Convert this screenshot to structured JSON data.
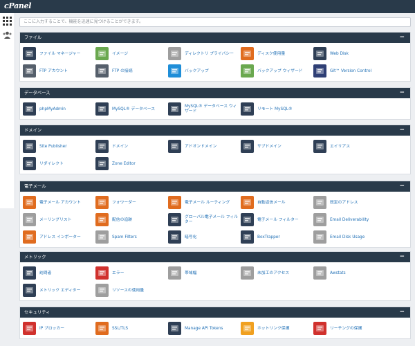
{
  "app": {
    "logo": "cPanel"
  },
  "search": {
    "placeholder": "ここに入力することで、機能を迅速に見つけることができます。"
  },
  "sections": [
    {
      "title": "ファイル",
      "toggle": "−",
      "items": [
        {
          "label": "ファイル マネージャー",
          "icon": "file-manager-icon",
          "color": "#2f3f55"
        },
        {
          "label": "イメージ",
          "icon": "images-icon",
          "color": "#6aa84f"
        },
        {
          "label": "ディレクトリ プライバシー",
          "icon": "folder-privacy-icon",
          "color": "#9e9e9e"
        },
        {
          "label": "ディスク使用量",
          "icon": "disk-usage-icon",
          "color": "#e06c1f"
        },
        {
          "label": "Web Disk",
          "icon": "web-disk-icon",
          "color": "#2f3f55"
        },
        {
          "label": "FTP アカウント",
          "icon": "ftp-accounts-icon",
          "color": "#555f6b"
        },
        {
          "label": "FTP の接続",
          "icon": "ftp-connections-icon",
          "color": "#555f6b"
        },
        {
          "label": "バックアップ",
          "icon": "backup-icon",
          "color": "#1f8ed8"
        },
        {
          "label": "バックアップ ウィザード",
          "icon": "backup-wizard-icon",
          "color": "#6aa84f"
        },
        {
          "label": "Git™ Version Control",
          "icon": "git-icon",
          "color": "#2f3f75"
        }
      ]
    },
    {
      "title": "データベース",
      "toggle": "−",
      "items": [
        {
          "label": "phpMyAdmin",
          "icon": "phpmyadmin-icon",
          "color": "#2f3f55"
        },
        {
          "label": "MySQL® データベース",
          "icon": "mysql-databases-icon",
          "color": "#2f3f55"
        },
        {
          "label": "MySQL® データベース ウィザード",
          "icon": "mysql-wizard-icon",
          "color": "#2f3f55"
        },
        {
          "label": "リモート MySQL®",
          "icon": "remote-mysql-icon",
          "color": "#2f3f55"
        }
      ]
    },
    {
      "title": "ドメイン",
      "toggle": "−",
      "items": [
        {
          "label": "Site Publisher",
          "icon": "site-publisher-icon",
          "color": "#2f3f55"
        },
        {
          "label": "ドメイン",
          "icon": "domains-icon",
          "color": "#2f3f55"
        },
        {
          "label": "アドオンドメイン",
          "icon": "addon-domains-icon",
          "color": "#2f3f55"
        },
        {
          "label": "サブドメイン",
          "icon": "subdomains-icon",
          "color": "#2f3f55"
        },
        {
          "label": "エイリアス",
          "icon": "aliases-icon",
          "color": "#2f3f55"
        },
        {
          "label": "リダイレクト",
          "icon": "redirects-icon",
          "color": "#2f3f55"
        },
        {
          "label": "Zone Editor",
          "icon": "zone-editor-icon",
          "color": "#2f3f55"
        }
      ]
    },
    {
      "title": "電子メール",
      "toggle": "−",
      "items": [
        {
          "label": "電子メール アカウント",
          "icon": "email-accounts-icon",
          "color": "#e06c1f"
        },
        {
          "label": "フォワーダー",
          "icon": "forwarders-icon",
          "color": "#e06c1f"
        },
        {
          "label": "電子メール ルーティング",
          "icon": "email-routing-icon",
          "color": "#e06c1f"
        },
        {
          "label": "自動返信メール",
          "icon": "autoresponders-icon",
          "color": "#e06c1f"
        },
        {
          "label": "既定のアドレス",
          "icon": "default-address-icon",
          "color": "#9e9e9e"
        },
        {
          "label": "メーリングリスト",
          "icon": "mailing-lists-icon",
          "color": "#9e9e9e"
        },
        {
          "label": "配信の追跡",
          "icon": "track-delivery-icon",
          "color": "#e06c1f"
        },
        {
          "label": "グローバル電子メール フィルター",
          "icon": "global-filters-icon",
          "color": "#2f3f55"
        },
        {
          "label": "電子メール フィルター",
          "icon": "email-filters-icon",
          "color": "#2f3f55"
        },
        {
          "label": "Email Deliverability",
          "icon": "email-deliverability-icon",
          "color": "#9e9e9e"
        },
        {
          "label": "アドレス インポーター",
          "icon": "address-importer-icon",
          "color": "#e06c1f"
        },
        {
          "label": "Spam Filters",
          "icon": "spam-filters-icon",
          "color": "#9e9e9e"
        },
        {
          "label": "暗号化",
          "icon": "encryption-icon",
          "color": "#2f3f55"
        },
        {
          "label": "BoxTrapper",
          "icon": "boxtrapper-icon",
          "color": "#2f3f55"
        },
        {
          "label": "Email Disk Usage",
          "icon": "email-disk-usage-icon",
          "color": "#9e9e9e"
        }
      ]
    },
    {
      "title": "メトリック",
      "toggle": "−",
      "items": [
        {
          "label": "訪問者",
          "icon": "visitors-icon",
          "color": "#2f3f55"
        },
        {
          "label": "エラー",
          "icon": "errors-icon",
          "color": "#d0312d"
        },
        {
          "label": "帯域幅",
          "icon": "bandwidth-icon",
          "color": "#9e9e9e"
        },
        {
          "label": "未加工のアクセス",
          "icon": "raw-access-icon",
          "color": "#9e9e9e"
        },
        {
          "label": "Awstats",
          "icon": "awstats-icon",
          "color": "#9e9e9e"
        },
        {
          "label": "メトリック エディター",
          "icon": "metrics-editor-icon",
          "color": "#2f3f55"
        },
        {
          "label": "リソースの使用量",
          "icon": "resource-usage-icon",
          "color": "#9e9e9e"
        }
      ]
    },
    {
      "title": "セキュリティ",
      "toggle": "−",
      "items": [
        {
          "label": "IP ブロッカー",
          "icon": "ip-blocker-icon",
          "color": "#d0312d"
        },
        {
          "label": "SSL/TLS",
          "icon": "ssl-tls-icon",
          "color": "#e06c1f"
        },
        {
          "label": "Manage API Tokens",
          "icon": "api-tokens-icon",
          "color": "#2f3f55"
        },
        {
          "label": "ホットリンク保護",
          "icon": "hotlink-protection-icon",
          "color": "#f0a020"
        },
        {
          "label": "リーチングの保護",
          "icon": "leech-protection-icon",
          "color": "#d0312d"
        }
      ]
    }
  ]
}
